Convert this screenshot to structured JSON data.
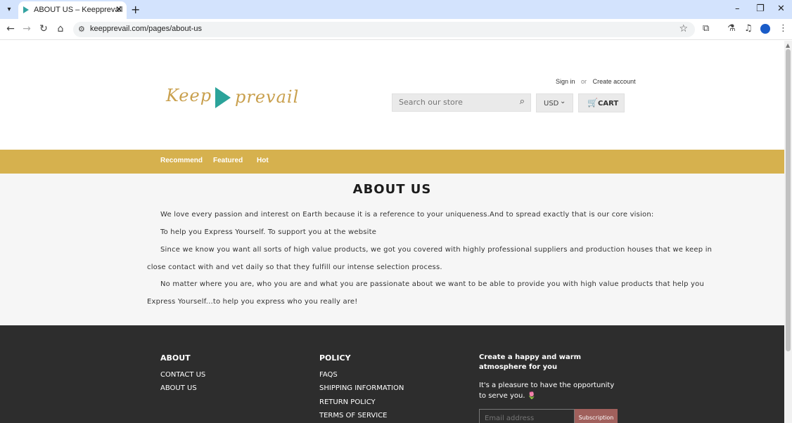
{
  "browser": {
    "tab_title": "ABOUT US – Keepprevail",
    "url": "keepprevail.com/pages/about-us"
  },
  "icons": {
    "tab_dropdown": "▾",
    "tab_close": "✕",
    "new_tab": "+",
    "minimize": "–",
    "restore": "❐",
    "close": "✕",
    "back": "←",
    "forward": "→",
    "reload": "↻",
    "home": "⌂",
    "site_info": "⚙",
    "bookmark": "☆",
    "extensions": "⧉",
    "labs": "⚗",
    "media": "♫",
    "menu": "⋮",
    "scroll_up": "▲",
    "search": "⌕",
    "chevron_down": "⌄",
    "cart": "🛒"
  },
  "header": {
    "logo_left": "Keep",
    "logo_right": "prevail",
    "sign_in": "Sign in",
    "or": "or",
    "create_account": "Create account",
    "search_placeholder": "Search our store",
    "currency": "USD",
    "cart_label": "CART"
  },
  "nav": {
    "items": [
      "Recommend",
      "Featured",
      "Hot"
    ]
  },
  "content": {
    "title": "ABOUT US",
    "lines": [
      "We love every passion and interest on Earth because it is a reference to your uniqueness.And to spread exactly that is our core vision:",
      "To help you Express Yourself. To support you at the website",
      "Since we know you want all sorts of high value products, we got you covered with highly professional suppliers and production houses that we keep in",
      "close contact with and vet daily so that they fulfill our intense selection process.",
      "No matter where you are, who you are and what you are passionate about we want to be able to provide you with high value products that help you",
      "Express Yourself...to help you express who you really are!"
    ]
  },
  "footer": {
    "about_heading": "ABOUT",
    "about_links": [
      "CONTACT US",
      "ABOUT US"
    ],
    "policy_heading": "POLICY",
    "policy_links": [
      "FAQS",
      "SHIPPING INFORMATION",
      "RETURN POLICY",
      "TERMS OF SERVICE"
    ],
    "newsletter_heading": "Create a happy and warm atmosphere for you",
    "newsletter_text": "It's a pleasure to have the opportunity to serve you.",
    "newsletter_emoji": "🌷",
    "email_placeholder": "Email address",
    "subscribe_label": "Subscription"
  },
  "colors": {
    "nav_gold": "#d6b14e",
    "footer_dark": "#2d2d2d",
    "subscribe_btn": "#a0605c",
    "logo_gold": "#c9a04e",
    "logo_teal": "#2ba39a"
  }
}
